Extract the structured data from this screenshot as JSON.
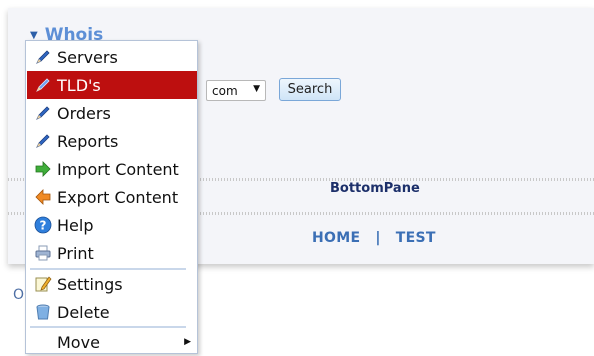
{
  "whois": {
    "title": "Whois"
  },
  "search": {
    "tld_value": "com",
    "button_label": "Search"
  },
  "layout": {
    "bottom_pane": "BottomPane"
  },
  "footer": {
    "home": "HOME",
    "sep": "|",
    "test": "TEST"
  },
  "partial": {
    "text": "O"
  },
  "menu": {
    "items": [
      {
        "label": "Servers",
        "icon": "pencil-icon"
      },
      {
        "label": "TLD's",
        "icon": "pencil-icon",
        "active": true
      },
      {
        "label": "Orders",
        "icon": "pencil-icon"
      },
      {
        "label": "Reports",
        "icon": "pencil-icon"
      },
      {
        "label": "Import Content",
        "icon": "arrow-right-icon"
      },
      {
        "label": "Export Content",
        "icon": "arrow-left-icon"
      },
      {
        "label": "Help",
        "icon": "help-icon"
      },
      {
        "label": "Print",
        "icon": "printer-icon"
      },
      {
        "label": "Settings",
        "icon": "settings-icon"
      },
      {
        "label": "Delete",
        "icon": "trash-icon"
      },
      {
        "label": "Move",
        "icon": ""
      }
    ]
  },
  "colors": {
    "accent": "#bd0f0f",
    "link": "#3b6fb5",
    "header": "#5d8fd6"
  }
}
